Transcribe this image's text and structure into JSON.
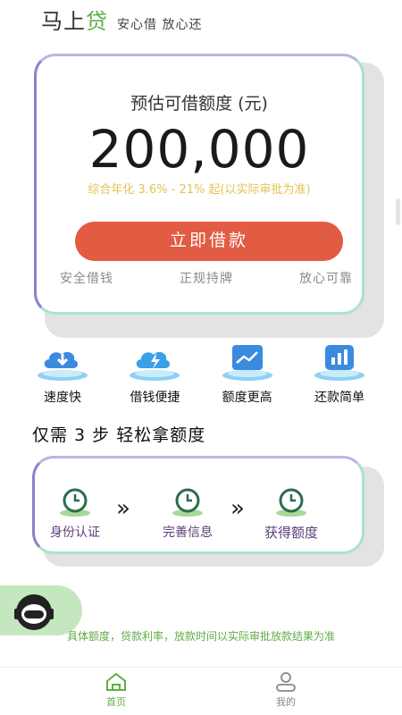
{
  "header": {
    "brand_main": "马上",
    "brand_accent": "贷",
    "slogan": "安心借 放心还"
  },
  "quota_card": {
    "title": "预估可借额度 (元)",
    "amount": "200,000",
    "rate_note": "综合年化 3.6% - 21% 起(以实际审批为准)",
    "borrow_button": "立即借款",
    "assurances": [
      "安全借钱",
      "正规持牌",
      "放心可靠"
    ]
  },
  "features": [
    {
      "label": "速度快",
      "icon": "download-cloud-icon"
    },
    {
      "label": "借钱便捷",
      "icon": "lightning-cloud-icon"
    },
    {
      "label": "额度更高",
      "icon": "trend-chart-icon"
    },
    {
      "label": "还款简单",
      "icon": "bar-chart-icon"
    }
  ],
  "steps": {
    "title": "仅需 3 步 轻松拿额度",
    "items": [
      {
        "label": "身份认证",
        "icon": "clock-icon"
      },
      {
        "label": "完善信息",
        "icon": "clock-icon"
      },
      {
        "label": "获得额度",
        "icon": "clock-icon"
      }
    ],
    "arrow": "»"
  },
  "support": {
    "icon": "customer-service-icon"
  },
  "disclaimer": "具体额度，贷款利率，放款时间以实际审批放款结果为准",
  "tabbar": {
    "tabs": [
      {
        "label": "首页",
        "icon": "home-icon",
        "active": true
      },
      {
        "label": "我的",
        "icon": "user-icon",
        "active": false
      }
    ]
  },
  "colors": {
    "brand_green": "#5fae45",
    "button_red": "#e25b43",
    "rate_yellow": "#e3c354",
    "step_purple": "#5a3f7a"
  }
}
